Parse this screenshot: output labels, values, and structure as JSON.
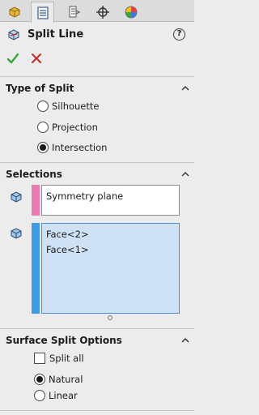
{
  "tabs": [
    {
      "icon": "feature-manager-icon",
      "active": false
    },
    {
      "icon": "property-manager-icon",
      "active": true
    },
    {
      "icon": "configuration-manager-icon",
      "active": false
    },
    {
      "icon": "dimxpert-icon",
      "active": false
    },
    {
      "icon": "display-manager-icon",
      "active": false
    }
  ],
  "header": {
    "title": "Split Line",
    "help": "?"
  },
  "type_of_split": {
    "label": "Type of Split",
    "options": [
      "Silhouette",
      "Projection",
      "Intersection"
    ],
    "selected": "Intersection"
  },
  "selections": {
    "label": "Selections",
    "plane_box": {
      "items": [
        "Symmetry plane"
      ],
      "color": "#e87bb0"
    },
    "faces_box": {
      "items": [
        "Face<2>",
        "Face<1>"
      ],
      "color": "#3d9be3"
    }
  },
  "surface_split_options": {
    "label": "Surface Split Options",
    "split_all_label": "Split all",
    "split_all_checked": false,
    "options": [
      "Natural",
      "Linear"
    ],
    "selected": "Natural"
  },
  "colors": {
    "ok": "#3aa63a",
    "cancel": "#c62828"
  }
}
